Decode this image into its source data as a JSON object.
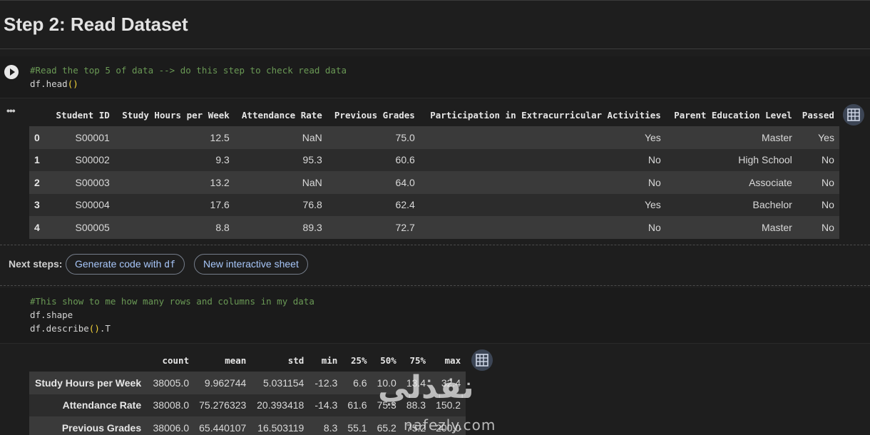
{
  "heading": "Step 2: Read Dataset",
  "cell1": {
    "comment": "#Read the top 5 of data --> do this step to check read data",
    "code_obj": "df.head",
    "code_paren": "()"
  },
  "table1": {
    "columns": [
      "Student ID",
      "Study Hours per Week",
      "Attendance Rate",
      "Previous Grades",
      "Participation in Extracurricular Activities",
      "Parent Education Level",
      "Passed"
    ],
    "rows": [
      {
        "idx": "0",
        "cells": [
          "S00001",
          "12.5",
          "NaN",
          "75.0",
          "Yes",
          "Master",
          "Yes"
        ]
      },
      {
        "idx": "1",
        "cells": [
          "S00002",
          "9.3",
          "95.3",
          "60.6",
          "No",
          "High School",
          "No"
        ]
      },
      {
        "idx": "2",
        "cells": [
          "S00003",
          "13.2",
          "NaN",
          "64.0",
          "No",
          "Associate",
          "No"
        ]
      },
      {
        "idx": "3",
        "cells": [
          "S00004",
          "17.6",
          "76.8",
          "62.4",
          "Yes",
          "Bachelor",
          "No"
        ]
      },
      {
        "idx": "4",
        "cells": [
          "S00005",
          "8.8",
          "89.3",
          "72.7",
          "No",
          "Master",
          "No"
        ]
      }
    ]
  },
  "next_steps": {
    "label": "Next steps:",
    "generate_prefix": "Generate code with ",
    "generate_var": "df",
    "interactive": "New interactive sheet"
  },
  "cell2": {
    "comment": "#This show to me how many rows and columns in my data",
    "line2": "df.shape",
    "line3_obj": "df.describe",
    "line3_paren": "()",
    "line3_suffix": ".T"
  },
  "table2": {
    "columns": [
      "count",
      "mean",
      "std",
      "min",
      "25%",
      "50%",
      "75%",
      "max"
    ],
    "rows": [
      {
        "idx": "Study Hours per Week",
        "cells": [
          "38005.0",
          "9.962744",
          "5.031154",
          "-12.3",
          "6.6",
          "10.0",
          "13.4",
          "32.4"
        ]
      },
      {
        "idx": "Attendance Rate",
        "cells": [
          "38008.0",
          "75.276323",
          "20.393418",
          "-14.3",
          "61.6",
          "75.3",
          "88.3",
          "150.2"
        ]
      },
      {
        "idx": "Previous Grades",
        "cells": [
          "38006.0",
          "65.440107",
          "16.503119",
          "8.3",
          "55.1",
          "65.2",
          "75.2",
          "200.0"
        ]
      }
    ]
  },
  "watermark": {
    "arabic": "نفذلي",
    "latin": "nafezly.com"
  },
  "colors": {
    "background": "#1e1e1e",
    "comment": "#6a9955",
    "paren": "#f4d43a",
    "chip_text": "#a8c7fa"
  }
}
